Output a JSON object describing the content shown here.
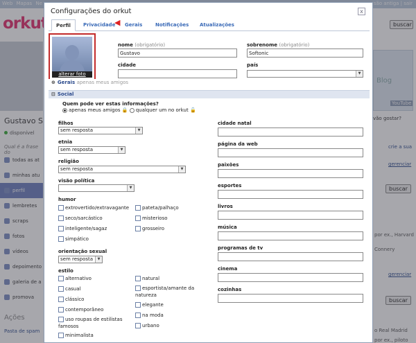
{
  "topbar": {
    "links": [
      "Web",
      "Mapas",
      "Ne"
    ],
    "right": "são antiga | sair"
  },
  "logo": "orkut",
  "left": {
    "name": "Gustavo S",
    "status": "disponível",
    "phrase": "Qual é a frase do",
    "nav": [
      "todas as at",
      "minhas atu",
      "perfil",
      "lembretes",
      "scraps",
      "fotos",
      "vídeos",
      "depoimento",
      "galeria de a",
      "promova"
    ],
    "acoes": "Ações",
    "pasta": "Pasta de spam"
  },
  "right": {
    "search_btn": "buscar",
    "ad_text": "Blog",
    "ad_logo": "YouTube",
    "question": "vão gostar?",
    "sua": "crie a sua",
    "gerenciar": "gerenciar",
    "buscar": "buscar",
    "por_ex": "por ex., Harvard",
    "connery": "Connery",
    "gerenciar2": "gerenciar",
    "buscar2": "buscar",
    "madrid": "o Real Madrid",
    "ex2": "por ex., piloto"
  },
  "modal": {
    "title": "Configurações do orkut",
    "close": "x",
    "tabs": [
      "Perfil",
      "Privacidade",
      "Gerais",
      "Notificações",
      "Atualizações"
    ],
    "alterar_foto": "alterar foto",
    "nome_label": "nome",
    "nome_req": "(obrigatório)",
    "nome_value": "Gustavo",
    "sobrenome_label": "sobrenome",
    "sobrenome_req": "(obrigatório)",
    "sobrenome_value": "Softonic",
    "cidade_label": "cidade",
    "pais_label": "país",
    "gerais_hdr": "Gerais",
    "gerais_sub": "apenas meus amigos",
    "social_hdr": "Social",
    "priv_q": "Quem pode ver estas informações?",
    "priv_opt1": "apenas meus amigos",
    "priv_opt2": "qualquer um no orkut",
    "filhos_label": "filhos",
    "filhos_value": "sem resposta",
    "etnia_label": "etnia",
    "etnia_value": "sem resposta",
    "religiao_label": "religião",
    "religiao_value": "sem resposta",
    "visao_label": "visão política",
    "humor_label": "humor",
    "humor_opts": [
      "extrovertido/extravagante",
      "pateta/palhaço",
      "seco/sarcástico",
      "misterioso",
      "inteligente/sagaz",
      "grosseiro",
      "simpático"
    ],
    "orient_label": "orientação sexual",
    "orient_value": "sem resposta",
    "estilo_label": "estilo",
    "estilo_left": [
      "alternativo",
      "casual",
      "clássico",
      "contemporâneo",
      "uso roupas de estilistas famosos",
      "minimalista"
    ],
    "estilo_right": [
      "natural",
      "esportista/amante da natureza",
      "elegante",
      "na moda",
      "urbano"
    ],
    "right_fields": [
      "cidade natal",
      "página da web",
      "paixões",
      "esportes",
      "livros",
      "música",
      "programas de tv",
      "cinema",
      "cozinhas"
    ]
  }
}
